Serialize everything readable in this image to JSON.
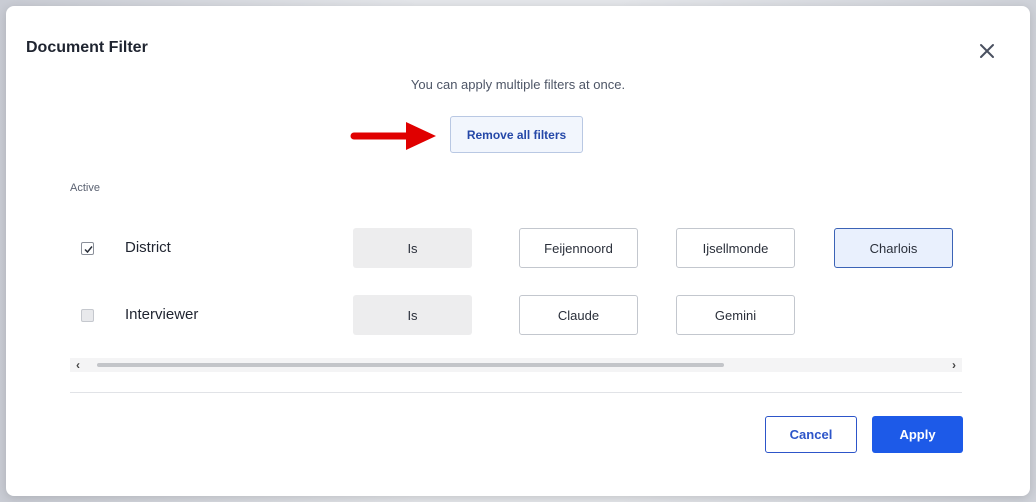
{
  "dialog": {
    "title": "Document Filter",
    "subtitle": "You can apply multiple filters at once.",
    "remove_all_label": "Remove all filters",
    "active_label": "Active"
  },
  "filters": [
    {
      "label": "District",
      "checked": true,
      "operator": "Is",
      "values": [
        {
          "label": "Feijennoord",
          "selected": false
        },
        {
          "label": "Ijsellmonde",
          "selected": false
        },
        {
          "label": "Charlois",
          "selected": true
        }
      ]
    },
    {
      "label": "Interviewer",
      "checked": false,
      "operator": "Is",
      "values": [
        {
          "label": "Claude",
          "selected": false
        },
        {
          "label": "Gemini",
          "selected": false
        }
      ]
    }
  ],
  "footer": {
    "cancel_label": "Cancel",
    "apply_label": "Apply"
  },
  "colors": {
    "primary": "#1d5ae8",
    "annotation_arrow": "#e00000"
  },
  "icons": {
    "close": "close-icon",
    "arrow": "red-arrow-annotation"
  }
}
